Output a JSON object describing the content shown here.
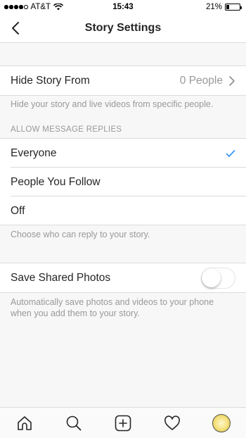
{
  "status_bar": {
    "carrier": "AT&T",
    "time": "15:43",
    "battery_percent": "21%",
    "battery_level": 0.21,
    "signal_bars_filled": 4,
    "signal_bars_total": 5
  },
  "header": {
    "title": "Story Settings",
    "back_icon": "chevron-left-icon"
  },
  "hide_story": {
    "label": "Hide Story From",
    "value": "0 People",
    "description": "Hide your story and live videos from specific people."
  },
  "message_replies": {
    "section_header": "ALLOW MESSAGE REPLIES",
    "options": [
      {
        "label": "Everyone",
        "selected": true
      },
      {
        "label": "People You Follow",
        "selected": false
      },
      {
        "label": "Off",
        "selected": false
      }
    ],
    "description": "Choose who can reply to your story."
  },
  "save_shared_photos": {
    "label": "Save Shared Photos",
    "enabled": false,
    "description_line1": "Automatically save photos and videos to your phone",
    "description_line2": "when you add them to your story."
  },
  "tab_bar": {
    "tabs": [
      {
        "name": "home",
        "icon": "home-icon"
      },
      {
        "name": "search",
        "icon": "search-icon"
      },
      {
        "name": "new-post",
        "icon": "plus-square-icon"
      },
      {
        "name": "activity",
        "icon": "heart-icon"
      },
      {
        "name": "profile",
        "icon": "avatar"
      }
    ]
  },
  "colors": {
    "accent": "#3897f0",
    "background": "#f7f7f8",
    "separator": "#dbdbdb",
    "secondary_text": "#999999"
  }
}
